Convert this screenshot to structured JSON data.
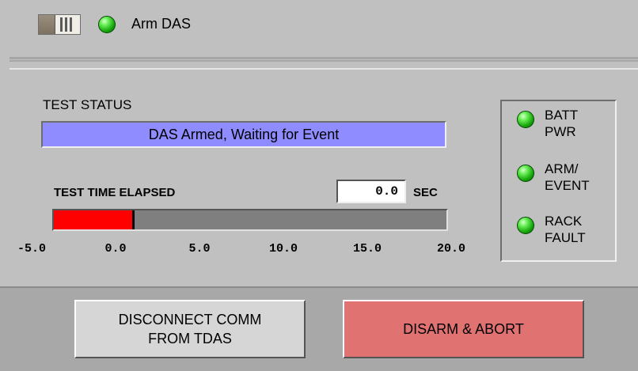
{
  "arm": {
    "label": "Arm DAS",
    "toggle_state": "on",
    "led_color": "#2fc81a"
  },
  "test_status": {
    "label": "TEST STATUS",
    "message": "DAS Armed, Waiting for Event",
    "display_color": "#8e8cff"
  },
  "elapsed": {
    "label": "TEST TIME ELAPSED",
    "value": "0.0",
    "unit": "SEC"
  },
  "progress": {
    "min": -5.0,
    "max": 20.0,
    "current": 0.0,
    "fill_color": "#ff0000",
    "ticks": [
      "-5.0",
      "0.0",
      "5.0",
      "10.0",
      "15.0",
      "20.0"
    ]
  },
  "indicators": [
    {
      "label": "BATT\nPWR",
      "color": "#2fc81a"
    },
    {
      "label": "ARM/\nEVENT",
      "color": "#2fc81a"
    },
    {
      "label": "RACK\nFAULT",
      "color": "#2fc81a"
    }
  ],
  "buttons": {
    "disconnect_label": "DISCONNECT COMM\nFROM TDAS",
    "disarm_label": "DISARM & ABORT"
  }
}
